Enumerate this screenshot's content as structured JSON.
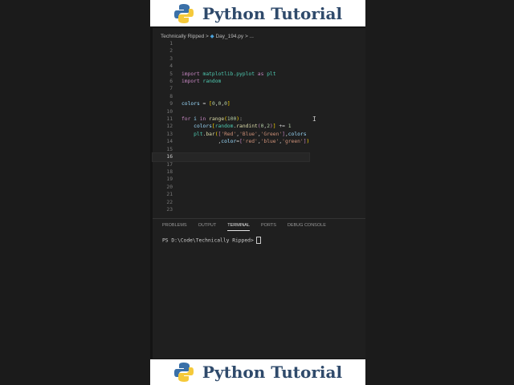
{
  "banner": {
    "title": "Python Tutorial",
    "logo": "python-logo"
  },
  "breadcrumb": {
    "folder": "Technically Ripped",
    "file": "Day_194.py",
    "more": "..."
  },
  "code": [
    {
      "n": "1",
      "h": ""
    },
    {
      "n": "2",
      "h": ""
    },
    {
      "n": "3",
      "h": ""
    },
    {
      "n": "4",
      "h": ""
    },
    {
      "n": "5",
      "h": "<span class='k'>import</span> <span class='m'>matplotlib.pyplot</span> <span class='k'>as</span> <span class='m'>plt</span>"
    },
    {
      "n": "6",
      "h": "<span class='k'>import</span> <span class='m'>random</span>"
    },
    {
      "n": "7",
      "h": ""
    },
    {
      "n": "8",
      "h": ""
    },
    {
      "n": "9",
      "h": "<span class='v'>colors</span> <span class='t'>=</span> <span class='p'>[</span><span class='n'>0</span><span class='t'>,</span><span class='n'>0</span><span class='t'>,</span><span class='n'>0</span><span class='p'>]</span>"
    },
    {
      "n": "10",
      "h": ""
    },
    {
      "n": "11",
      "h": "<span class='k'>for</span> <span class='v'>i</span> <span class='k'>in</span> <span class='f'>range</span><span class='p'>(</span><span class='n'>100</span><span class='p'>)</span><span class='t'>:</span>"
    },
    {
      "n": "12",
      "h": "    <span class='v'>colors</span><span class='p'>[</span><span class='m'>random</span><span class='t'>.</span><span class='f'>randint</span><span class='k'>(</span><span class='n'>0</span><span class='t'>,</span><span class='n'>2</span><span class='k'>)</span><span class='p'>]</span> <span class='t'>+=</span> <span class='n'>1</span>"
    },
    {
      "n": "13",
      "h": "    <span class='m'>plt</span><span class='t'>.</span><span class='f'>bar</span><span class='p'>(</span><span class='k'>[</span><span class='s'>'Red'</span><span class='t'>,</span><span class='s'>'Blue'</span><span class='t'>,</span><span class='s'>'Green'</span><span class='k'>]</span><span class='t'>,</span><span class='v'>colors</span>"
    },
    {
      "n": "14",
      "h": "            <span class='t'>,</span><span class='v'>color</span><span class='t'>=</span><span class='k'>[</span><span class='s'>'red'</span><span class='t'>,</span><span class='s'>'blue'</span><span class='t'>,</span><span class='s'>'green'</span><span class='k'>]</span><span class='p'>)</span>"
    },
    {
      "n": "15",
      "h": ""
    },
    {
      "n": "16",
      "h": "",
      "cur": true
    },
    {
      "n": "17",
      "h": ""
    },
    {
      "n": "18",
      "h": ""
    },
    {
      "n": "19",
      "h": ""
    },
    {
      "n": "20",
      "h": ""
    },
    {
      "n": "21",
      "h": ""
    },
    {
      "n": "22",
      "h": ""
    },
    {
      "n": "23",
      "h": ""
    }
  ],
  "panel": {
    "tabs": [
      "PROBLEMS",
      "OUTPUT",
      "TERMINAL",
      "PORTS",
      "DEBUG CONSOLE"
    ],
    "active": "TERMINAL",
    "prompt": "PS D:\\Code\\Technically Ripped>"
  }
}
